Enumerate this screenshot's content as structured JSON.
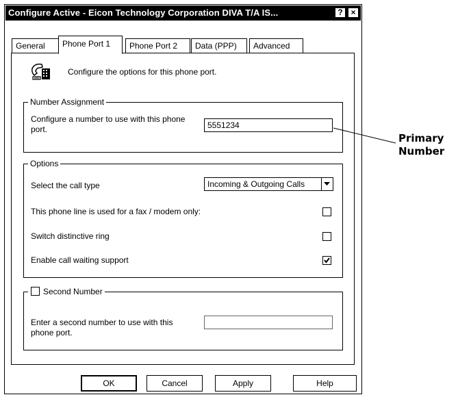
{
  "window": {
    "title": "Configure Active - Eicon Technology Corporation DIVA T/A IS...",
    "help_glyph": "?",
    "close_glyph": "×"
  },
  "tabs": [
    {
      "label": "General"
    },
    {
      "label": "Phone Port 1",
      "active": true
    },
    {
      "label": "Phone Port 2"
    },
    {
      "label": "Data (PPP)"
    },
    {
      "label": "Advanced"
    }
  ],
  "header": {
    "icon": "phone-port-icon",
    "text": "Configure the options for this phone port."
  },
  "number_assignment": {
    "title": "Number Assignment",
    "prompt": "Configure a number to use with this phone port.",
    "value": "5551234"
  },
  "options": {
    "title": "Options",
    "call_type_label": "Select the call type",
    "call_type_value": "Incoming & Outgoing Calls",
    "fax_modem_label": "This phone line is used for a fax / modem only:",
    "fax_modem_checked": false,
    "distinctive_ring_label": "Switch distinctive ring",
    "distinctive_ring_checked": false,
    "call_waiting_label": "Enable call waiting support",
    "call_waiting_checked": true
  },
  "second_number": {
    "title": "Second Number",
    "checked": false,
    "prompt": "Enter a second number to use with this phone port.",
    "value": ""
  },
  "buttons": {
    "ok": "OK",
    "cancel": "Cancel",
    "apply": "Apply",
    "help": "Help"
  },
  "callout": {
    "line1": "Primary",
    "line2": "Number"
  }
}
